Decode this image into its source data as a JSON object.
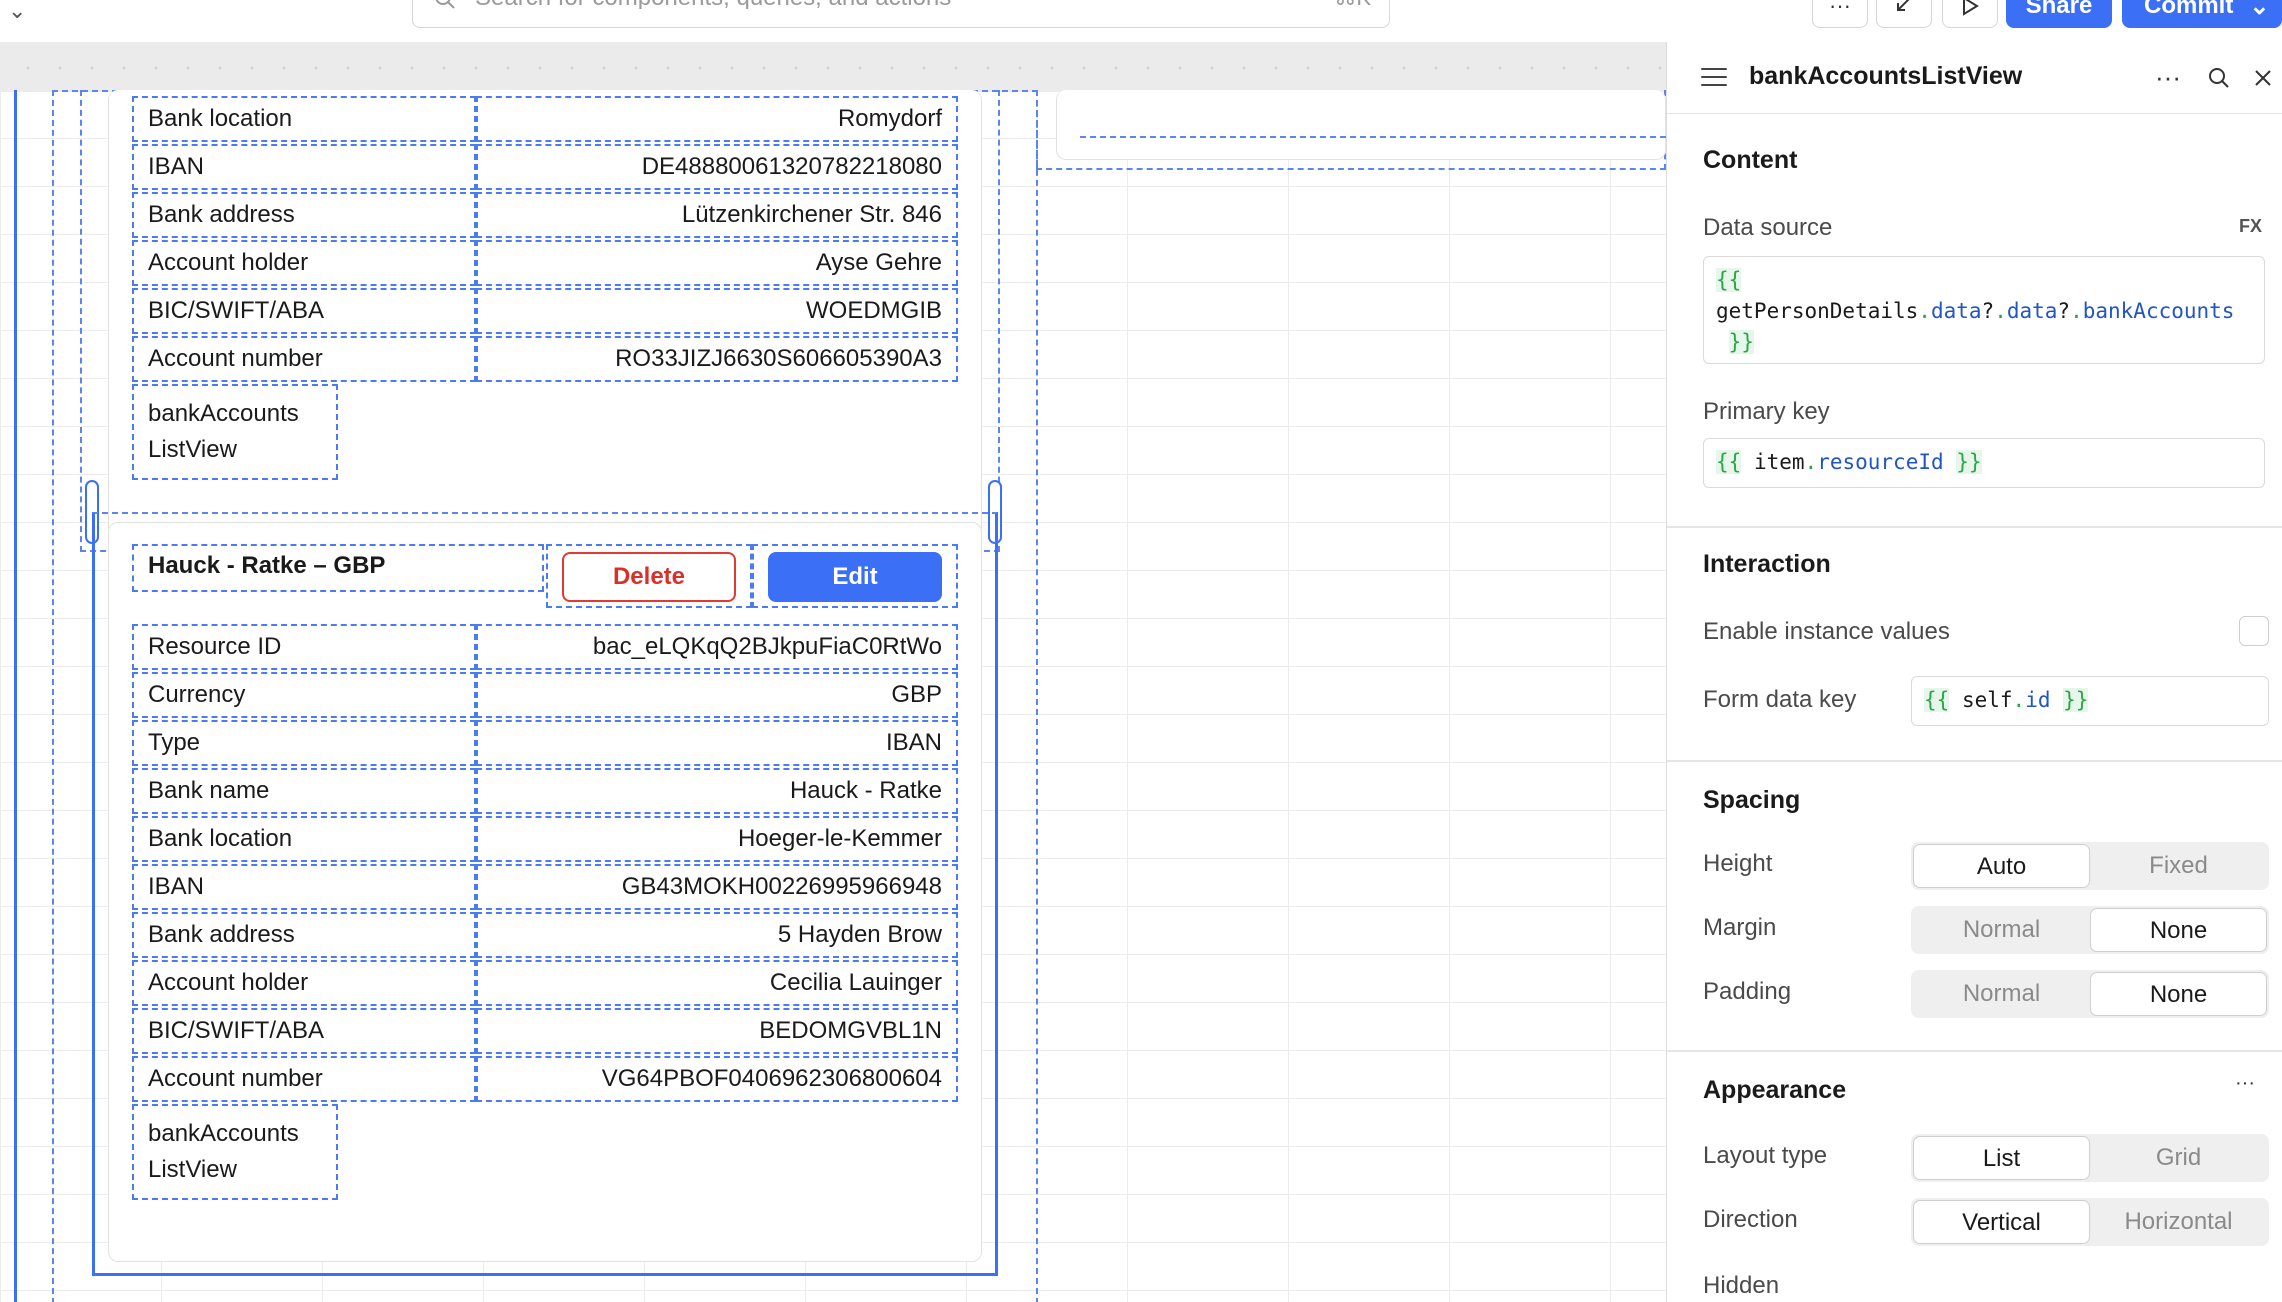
{
  "topbar": {
    "search_placeholder": "Search for components, queries, and actions",
    "search_shortcut": "⌘K",
    "more_label": "···",
    "share_label": "Share",
    "commit_label": "Commit"
  },
  "card1": {
    "rows": [
      {
        "label": "Bank location",
        "value": "Romydorf"
      },
      {
        "label": "IBAN",
        "value": "DE48880061320782218080"
      },
      {
        "label": "Bank address",
        "value": "Lützenkirchener Str. 846"
      },
      {
        "label": "Account holder",
        "value": "Ayse Gehre"
      },
      {
        "label": "BIC/SWIFT/ABA",
        "value": "WOEDMGIB"
      },
      {
        "label": "Account number",
        "value": "RO33JIZJ6630S606605390A3"
      }
    ],
    "listview_label_1": "bankAccounts",
    "listview_label_2": "ListView"
  },
  "card2": {
    "title": "Hauck - Ratke – GBP",
    "delete_label": "Delete",
    "edit_label": "Edit",
    "rows": [
      {
        "label": "Resource ID",
        "value": "bac_eLQKqQ2BJkpuFiaC0RtWo"
      },
      {
        "label": "Currency",
        "value": "GBP"
      },
      {
        "label": "Type",
        "value": "IBAN"
      },
      {
        "label": "Bank name",
        "value": "Hauck - Ratke"
      },
      {
        "label": "Bank location",
        "value": "Hoeger-le-Kemmer"
      },
      {
        "label": "IBAN",
        "value": "GB43MOKH00226995966948"
      },
      {
        "label": "Bank address",
        "value": "5 Hayden Brow"
      },
      {
        "label": "Account holder",
        "value": "Cecilia Lauinger"
      },
      {
        "label": "BIC/SWIFT/ABA",
        "value": "BEDOMGVBL1N"
      },
      {
        "label": "Account number",
        "value": "VG64PBOF0406962306800604"
      }
    ],
    "listview_label_1": "bankAccounts",
    "listview_label_2": "ListView"
  },
  "panel": {
    "title": "bankAccountsListView",
    "content_title": "Content",
    "data_source_label": "Data source",
    "fx_label": "FX",
    "data_source_open": "{{",
    "data_source_obj": "getPersonDetails",
    "data_source_p1": "data",
    "data_source_p2": "data",
    "data_source_p3": "bankAccounts",
    "data_source_close": "}}",
    "primary_key_label": "Primary key",
    "primary_key_open": "{{",
    "primary_key_obj": "item",
    "primary_key_prop": "resourceId",
    "primary_key_close": "}}",
    "interaction_title": "Interaction",
    "enable_instance_label": "Enable instance values",
    "form_data_key_label": "Form data key",
    "form_key_open": "{{",
    "form_key_obj": "self",
    "form_key_prop": "id",
    "form_key_close": "}}",
    "spacing_title": "Spacing",
    "height_label": "Height",
    "height_opts": [
      "Auto",
      "Fixed"
    ],
    "height_selected": "Auto",
    "margin_label": "Margin",
    "margin_opts": [
      "Normal",
      "None"
    ],
    "margin_selected": "None",
    "padding_label": "Padding",
    "padding_opts": [
      "Normal",
      "None"
    ],
    "padding_selected": "None",
    "appearance_title": "Appearance",
    "appearance_more": "···",
    "layout_type_label": "Layout type",
    "layout_opts": [
      "List",
      "Grid"
    ],
    "layout_selected": "List",
    "direction_label": "Direction",
    "direction_opts": [
      "Vertical",
      "Horizontal"
    ],
    "direction_selected": "Vertical",
    "hidden_label": "Hidden"
  }
}
